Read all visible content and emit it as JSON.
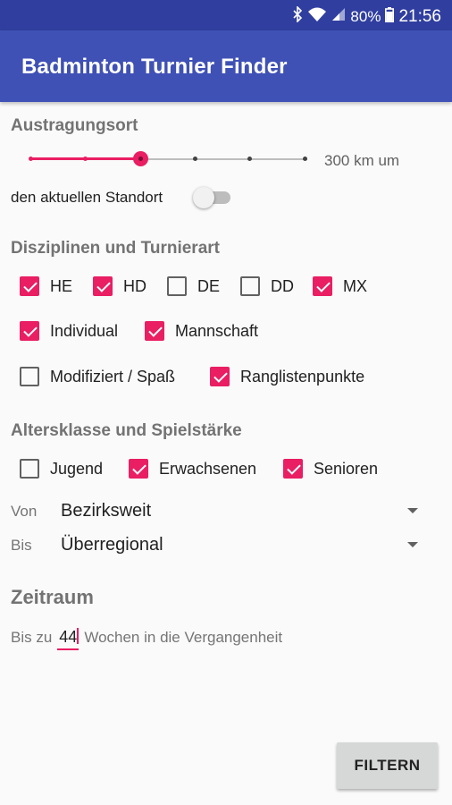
{
  "status_bar": {
    "icons": [
      "bluetooth-icon",
      "wifi-icon",
      "signal-icon"
    ],
    "battery": "80%",
    "time": "21:56"
  },
  "app_bar": {
    "title": "Badminton Turnier Finder"
  },
  "austragungsort": {
    "title": "Austragungsort",
    "slider_value_label": "300 km um",
    "slider_steps": 6,
    "slider_selected_index": 2,
    "location_label": "den aktuellen Standort",
    "location_switch_on": false
  },
  "disziplinen": {
    "title": "Disziplinen und Turnierart",
    "items": [
      {
        "label": "HE",
        "checked": true
      },
      {
        "label": "HD",
        "checked": true
      },
      {
        "label": "DE",
        "checked": false
      },
      {
        "label": "DD",
        "checked": false
      },
      {
        "label": "MX",
        "checked": true
      },
      {
        "label": "Individual",
        "checked": true
      },
      {
        "label": "Mannschaft",
        "checked": true
      },
      {
        "label": "Modifiziert / Spaß",
        "checked": false
      },
      {
        "label": "Ranglistenpunkte",
        "checked": true
      }
    ]
  },
  "altersklasse": {
    "title": "Altersklasse und Spielstärke",
    "items": [
      {
        "label": "Jugend",
        "checked": false
      },
      {
        "label": "Erwachsenen",
        "checked": true
      },
      {
        "label": "Senioren",
        "checked": true
      }
    ],
    "von_label": "Von",
    "von_value": "Bezirksweit",
    "bis_label": "Bis",
    "bis_value": "Überregional"
  },
  "zeitraum": {
    "title": "Zeitraum",
    "prefix": "Bis zu",
    "weeks_value": "44",
    "suffix": "Wochen in die Vergangenheit"
  },
  "filter_button": {
    "label": "FILTERN"
  },
  "colors": {
    "primary": "#3f51b5",
    "primary_dark": "#303f9f",
    "accent": "#e91e63"
  }
}
